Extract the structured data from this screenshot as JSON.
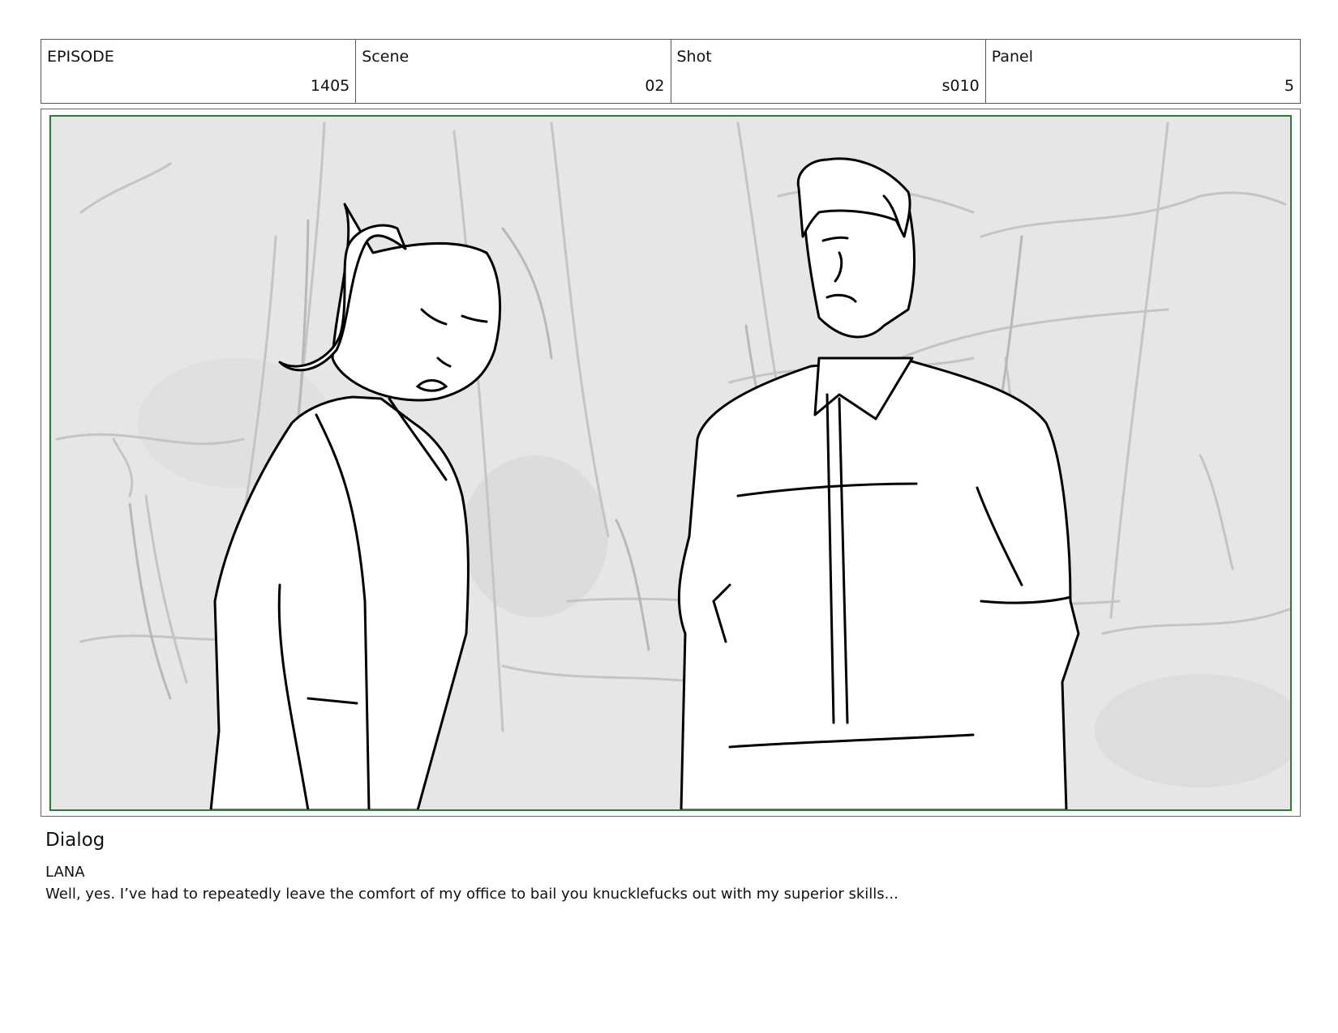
{
  "header": {
    "episode": {
      "label": "EPISODE",
      "value": "1405"
    },
    "scene": {
      "label": "Scene",
      "value": "02"
    },
    "shot": {
      "label": "Shot",
      "value": "s010"
    },
    "panel": {
      "label": "Panel",
      "value": "5"
    }
  },
  "dialog": {
    "heading": "Dialog",
    "character": "LANA",
    "line": "Well, yes. I’ve had to repeatedly leave the comfort of my office to bail you knucklefucks out with my superior skills..."
  },
  "colors": {
    "safe_frame": "#2e7d32",
    "background_sketch": "#e8e8e8"
  }
}
